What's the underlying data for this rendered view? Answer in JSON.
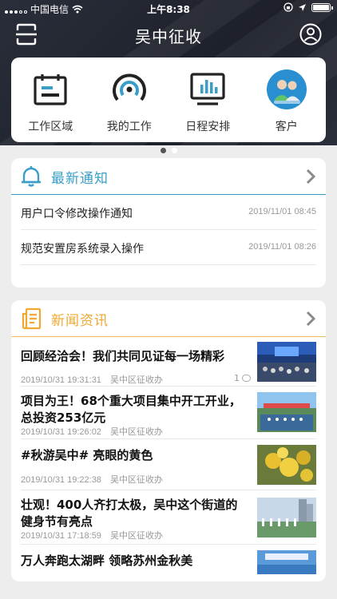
{
  "status_bar": {
    "carrier": "中国电信",
    "time": "上午8:38"
  },
  "app": {
    "title": "吴中征收"
  },
  "quick_actions": [
    {
      "label": "工作区域",
      "icon": "calendar-board-icon"
    },
    {
      "label": "我的工作",
      "icon": "signal-target-icon"
    },
    {
      "label": "日程安排",
      "icon": "monitor-chart-icon"
    },
    {
      "label": "客户",
      "icon": "customers-icon"
    }
  ],
  "notices": {
    "title": "最新通知",
    "accent": "#3a9ec9",
    "items": [
      {
        "title": "用户口令修改操作通知",
        "date": "2019/11/01 08:45"
      },
      {
        "title": "规范安置房系统录入操作",
        "date": "2019/11/01 08:26"
      }
    ]
  },
  "news": {
    "title": "新闻资讯",
    "accent": "#f0a830",
    "items": [
      {
        "title": "回顾经洽会！我们共同见证每一场精彩",
        "date": "2019/10/31 19:31:31",
        "source": "吴中区征收办",
        "comments": "1"
      },
      {
        "title": "项目为王！68个重大项目集中开工开业，总投资253亿元",
        "date": "2019/10/31 19:26:02",
        "source": "吴中区征收办"
      },
      {
        "title": "#秋游吴中# 亮眼的黄色",
        "date": "2019/10/31 19:22:38",
        "source": "吴中区征收办"
      },
      {
        "title": "壮观！400人齐打太极，吴中这个街道的健身节有亮点",
        "date": "2019/10/31 17:18:59",
        "source": "吴中区征收办"
      },
      {
        "title": "万人奔跑太湖畔 领略苏州金秋美",
        "date": "",
        "source": ""
      }
    ]
  }
}
